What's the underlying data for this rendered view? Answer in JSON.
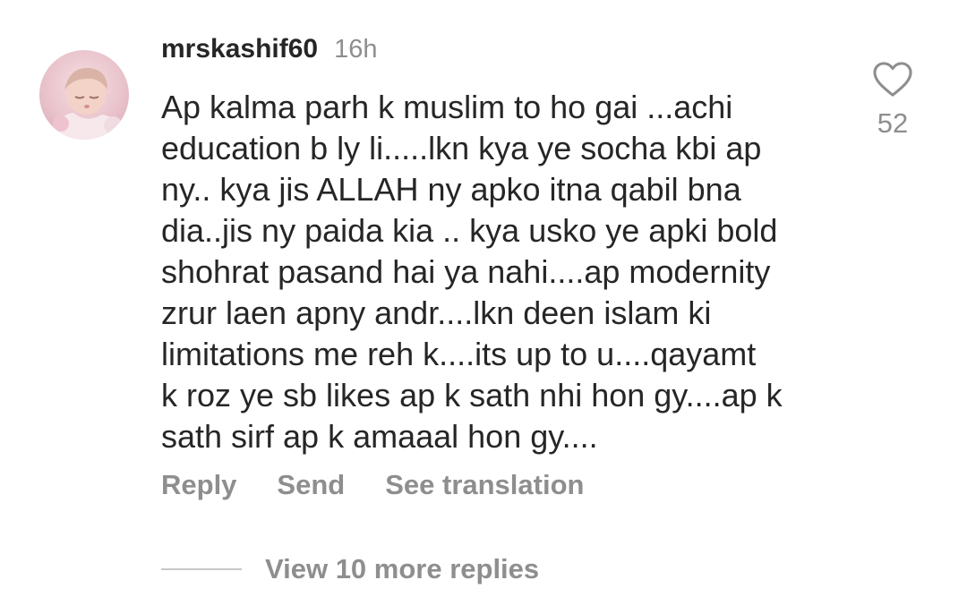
{
  "comment": {
    "username": "mrskashif60",
    "timestamp": "16h",
    "text": "Ap kalma parh k muslim to ho gai ...achi\neducation b ly li.....lkn kya ye socha kbi ap\nny.. kya jis ALLAH ny apko itna qabil bna\ndia..jis ny paida kia .. kya usko ye apki bold\nshohrat pasand hai ya nahi....ap modernity\nzrur laen apny andr....lkn deen islam ki\nlimitations me reh k....its up to u....qayamt\nk roz ye sb likes ap k sath nhi hon gy....ap k\nsath sirf ap k amaaal hon gy....",
    "like_count": "52",
    "like_icon": "heart-outline-icon",
    "avatar": "profile-photo-avatar"
  },
  "actions": {
    "reply": "Reply",
    "send": "Send",
    "see_translation": "See translation"
  },
  "replies": {
    "label": "View 10 more replies"
  },
  "colors": {
    "text_primary": "#262626",
    "text_secondary": "#8e8e8e",
    "divider": "#c7c7c7",
    "background": "#ffffff"
  }
}
